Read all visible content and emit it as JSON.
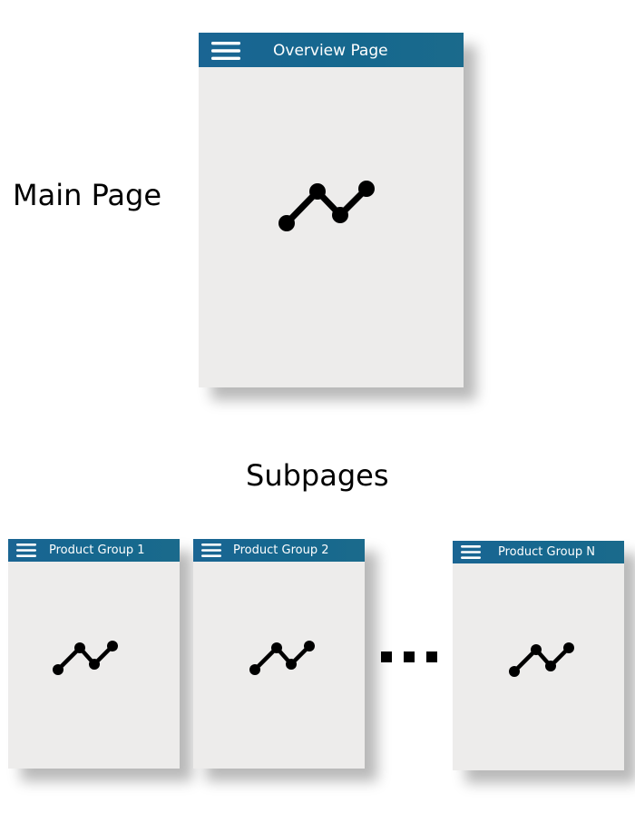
{
  "labels": {
    "main_page": "Main Page",
    "subpages": "Subpages"
  },
  "main_page": {
    "title": "Overview Page",
    "icons": [
      "hamburger-menu-icon",
      "line-chart-icon"
    ]
  },
  "subpages": [
    {
      "title": "Product Group 1"
    },
    {
      "title": "Product Group 2"
    },
    {
      "title": "Product Group N"
    }
  ],
  "colors": {
    "header": "#18678f",
    "screen_background": "#edeceb",
    "icon": "#000000",
    "header_text": "#ffffff"
  }
}
